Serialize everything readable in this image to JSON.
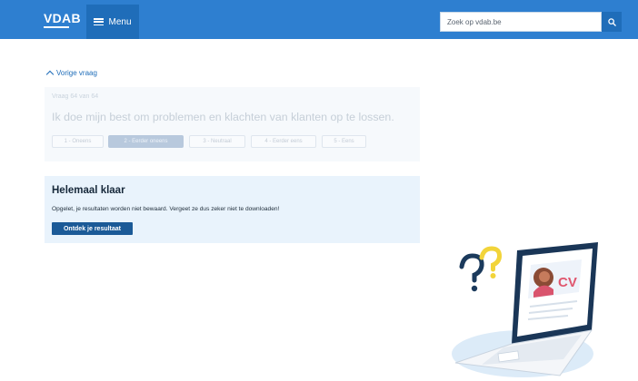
{
  "header": {
    "logo_text": "VDAB",
    "menu_label": "Menu",
    "search": {
      "placeholder": "Zoek op vdab.be",
      "value": ""
    }
  },
  "navigation": {
    "back_label": "Vorige vraag"
  },
  "question": {
    "counter": "Vraag 64 van 64",
    "text": "Ik doe mijn best om problemen en klachten van klanten op te lossen.",
    "answers": [
      {
        "label": "1 - Oneens",
        "selected": false
      },
      {
        "label": "2 - Eerder oneens",
        "selected": true
      },
      {
        "label": "3 - Neutraal",
        "selected": false
      },
      {
        "label": "4 - Eerder eens",
        "selected": false
      },
      {
        "label": "5 - Eens",
        "selected": false
      }
    ]
  },
  "completion": {
    "title": "Helemaal klaar",
    "message": "Opgelet, je resultaten worden niet bewaard. Vergeet ze dus zeker niet te downloaden!",
    "button_label": "Ontdek je resultaat"
  },
  "illustration": {
    "cv_text": "CV"
  },
  "colors": {
    "header": "#2e7fd0",
    "accent_dark": "#1b5a97",
    "card_background": "#e9f3fc",
    "question_faded": "#c6cfd8",
    "illustration_yellow": "#f2d43a"
  }
}
